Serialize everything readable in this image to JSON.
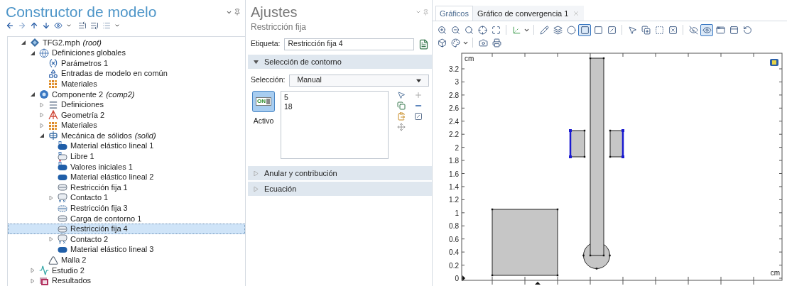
{
  "builder": {
    "title": "Constructor de modelo",
    "tree": [
      {
        "label": "TFG2.mph",
        "tag": "(root)",
        "kind": "root",
        "expanded": true,
        "selected": false,
        "children": [
          {
            "label": "Definiciones globales",
            "kind": "globe",
            "expanded": true,
            "selected": false,
            "children": [
              {
                "label": "Parámetros 1",
                "kind": "parameters",
                "selected": false
              },
              {
                "label": "Entradas de modelo en común",
                "kind": "inputs",
                "selected": false
              },
              {
                "label": "Materiales",
                "kind": "materials",
                "selected": false
              }
            ]
          },
          {
            "label": "Componente 2",
            "tag": "(comp2)",
            "kind": "component",
            "expanded": true,
            "selected": false,
            "children": [
              {
                "label": "Definiciones",
                "kind": "definitions",
                "expanded": false,
                "selected": false
              },
              {
                "label": "Geometría 2",
                "kind": "geometry",
                "expanded": false,
                "selected": false
              },
              {
                "label": "Materiales",
                "kind": "materials",
                "expanded": false,
                "selected": false
              },
              {
                "label": "Mecánica de sólidos",
                "tag": "(solid)",
                "kind": "physics",
                "expanded": true,
                "selected": false,
                "children": [
                  {
                    "label": "Material elástico lineal 1",
                    "kind": "material-default",
                    "selected": false
                  },
                  {
                    "label": "Libre 1",
                    "kind": "free",
                    "selected": false
                  },
                  {
                    "label": "Valores iniciales 1",
                    "kind": "material-default",
                    "selected": false
                  },
                  {
                    "label": "Material elástico lineal 2",
                    "kind": "material",
                    "selected": false
                  },
                  {
                    "label": "Restricción fija 1",
                    "kind": "boundary",
                    "selected": false
                  },
                  {
                    "label": "Contacto 1",
                    "kind": "contact",
                    "expanded": false,
                    "selected": false
                  },
                  {
                    "label": "Restricción fija 3",
                    "kind": "boundary-dashed",
                    "selected": false
                  },
                  {
                    "label": "Carga de contorno 1",
                    "kind": "boundary",
                    "selected": false
                  },
                  {
                    "label": "Restricción fija 4",
                    "kind": "boundary",
                    "selected": true
                  },
                  {
                    "label": "Contacto 2",
                    "kind": "contact",
                    "expanded": false,
                    "selected": false
                  },
                  {
                    "label": "Material elástico lineal 3",
                    "kind": "material",
                    "selected": false
                  }
                ]
              },
              {
                "label": "Malla 2",
                "kind": "mesh",
                "selected": false
              }
            ]
          },
          {
            "label": "Estudio 2",
            "kind": "study",
            "expanded": false,
            "selected": false
          },
          {
            "label": "Resultados",
            "kind": "results",
            "expanded": false,
            "selected": false
          }
        ]
      }
    ]
  },
  "settings": {
    "title": "Ajustes",
    "subtitle": "Restricción fija",
    "label_field": {
      "label": "Etiqueta:",
      "value": "Restricción fija 4"
    },
    "sections": [
      {
        "title": "Selección de contorno",
        "expanded": true,
        "selection": {
          "label": "Selección:",
          "value": "Manual",
          "toggle_text": "ON",
          "on": true,
          "toggle_label": "Activo",
          "entities": [
            "5",
            "18"
          ]
        }
      },
      {
        "title": "Anular y contribución",
        "expanded": false
      },
      {
        "title": "Ecuación",
        "expanded": false
      }
    ]
  },
  "graphics": {
    "tabs": [
      {
        "label": "Gráficos",
        "selected": true,
        "closable": false
      },
      {
        "label": "Gráfico de convergencia 1",
        "selected": false,
        "closable": true
      }
    ],
    "toolbar": [
      {
        "kind": "zoom-in",
        "pressed": false
      },
      {
        "kind": "zoom-out",
        "pressed": false
      },
      {
        "kind": "zoom-box",
        "pressed": false
      },
      {
        "kind": "center",
        "pressed": false
      },
      {
        "kind": "extents",
        "pressed": false
      },
      {
        "kind": "separator"
      },
      {
        "kind": "axis",
        "pressed": false
      },
      {
        "kind": "separator"
      },
      {
        "kind": "edit",
        "pressed": false
      },
      {
        "kind": "layers",
        "pressed": false
      },
      {
        "kind": "fill",
        "pressed": false
      },
      {
        "kind": "boundary",
        "pressed": true
      },
      {
        "kind": "boundary-light",
        "pressed": false
      },
      {
        "kind": "hide",
        "pressed": false
      },
      {
        "kind": "separator"
      },
      {
        "kind": "select",
        "pressed": false
      },
      {
        "kind": "select-all",
        "pressed": false
      },
      {
        "kind": "box-select",
        "pressed": false
      },
      {
        "kind": "clear",
        "pressed": false
      },
      {
        "kind": "separator"
      },
      {
        "kind": "eye-off",
        "pressed": false
      },
      {
        "kind": "eye",
        "pressed": true
      },
      {
        "kind": "view",
        "pressed": false
      },
      {
        "kind": "view-alt",
        "pressed": false
      },
      {
        "kind": "reset",
        "pressed": false
      }
    ],
    "toolbar_2": [
      {
        "kind": "scene",
        "pressed": false
      },
      {
        "kind": "palette",
        "pressed": false
      },
      {
        "kind": "separator"
      },
      {
        "kind": "camera",
        "pressed": false
      },
      {
        "kind": "print",
        "pressed": false
      }
    ],
    "plot": {
      "unit_top": "cm",
      "unit_bottom": "cm",
      "y_ticks": [
        "3.2",
        "3",
        "2.8",
        "2.6",
        "2.4",
        "2.2",
        "2",
        "1.8",
        "1.6",
        "1.4",
        "1.2",
        "1",
        "0.8",
        "0.6",
        "0.4",
        "0.2",
        "0"
      ]
    }
  }
}
